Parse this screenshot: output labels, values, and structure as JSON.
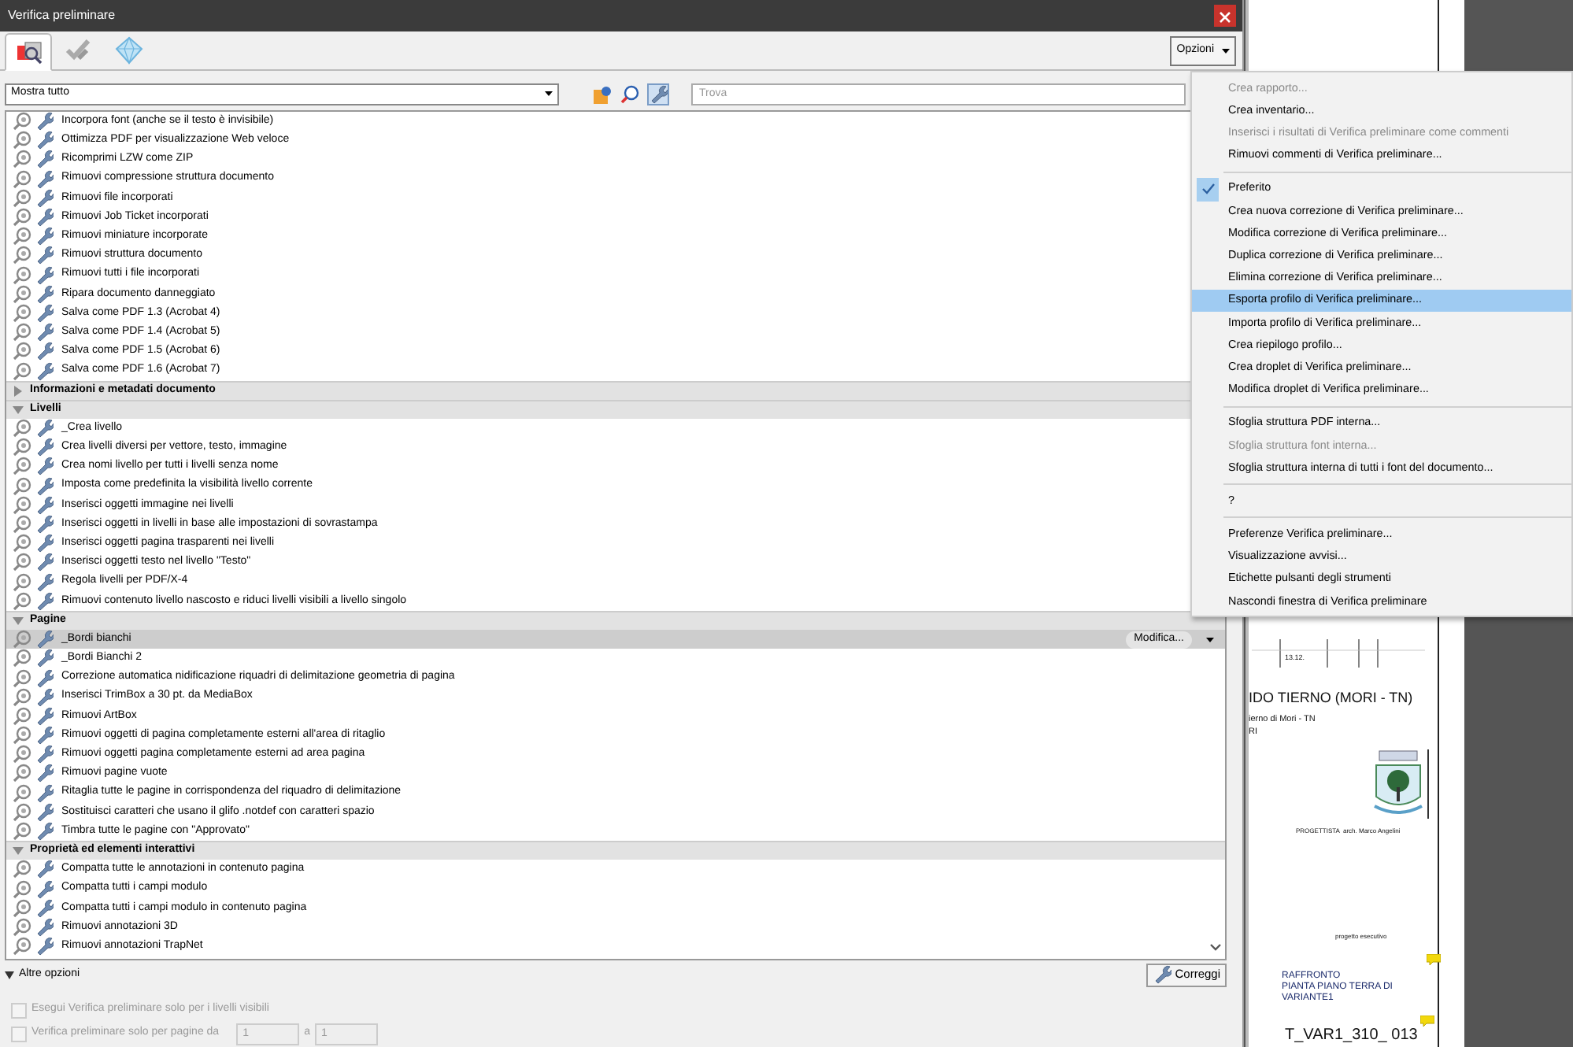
{
  "window": {
    "title": "Verifica preliminare"
  },
  "tabs": [
    {
      "kind": "profiles",
      "selected": true
    },
    {
      "kind": "results",
      "selected": false
    },
    {
      "kind": "standards",
      "selected": false
    }
  ],
  "options_button": "Opzioni",
  "filter": {
    "value": "Mostra tutto"
  },
  "view_buttons": [
    {
      "kind": "checks",
      "selected": false
    },
    {
      "kind": "profiles",
      "selected": false
    },
    {
      "kind": "fixups",
      "selected": true
    }
  ],
  "search": {
    "placeholder": "Trova"
  },
  "list": {
    "row_button": "Modifica...",
    "groups": [
      {
        "items": [
          {
            "label": "Incorpora font (anche se il testo è invisibile)",
            "selected": false
          },
          {
            "label": "Ottimizza PDF per visualizzazione Web veloce",
            "selected": false
          },
          {
            "label": "Ricomprimi LZW come ZIP",
            "selected": false
          },
          {
            "label": "Rimuovi compressione struttura documento",
            "selected": false
          },
          {
            "label": "Rimuovi file incorporati",
            "selected": false
          },
          {
            "label": "Rimuovi Job Ticket incorporati",
            "selected": false
          },
          {
            "label": "Rimuovi miniature incorporate",
            "selected": false
          },
          {
            "label": "Rimuovi struttura documento",
            "selected": false
          },
          {
            "label": "Rimuovi tutti i file incorporati",
            "selected": false
          },
          {
            "label": "Ripara documento danneggiato",
            "selected": false
          },
          {
            "label": "Salva come PDF 1.3 (Acrobat 4)",
            "selected": false
          },
          {
            "label": "Salva come PDF 1.4 (Acrobat 5)",
            "selected": false
          },
          {
            "label": "Salva come PDF 1.5 (Acrobat 6)",
            "selected": false
          },
          {
            "label": "Salva come PDF 1.6 (Acrobat 7)",
            "selected": false
          }
        ]
      },
      {
        "title": "Informazioni e metadati documento",
        "expanded": false
      },
      {
        "title": "Livelli",
        "expanded": true,
        "items": [
          {
            "label": "_Crea livello",
            "selected": false
          },
          {
            "label": "Crea livelli diversi per vettore, testo, immagine",
            "selected": false
          },
          {
            "label": "Crea nomi livello per tutti i livelli senza nome",
            "selected": false
          },
          {
            "label": "Imposta come predefinita la visibilità livello corrente",
            "selected": false
          },
          {
            "label": "Inserisci oggetti immagine nei livelli",
            "selected": false
          },
          {
            "label": "Inserisci oggetti in livelli in base alle impostazioni di sovrastampa",
            "selected": false
          },
          {
            "label": "Inserisci oggetti pagina trasparenti nei livelli",
            "selected": false
          },
          {
            "label": "Inserisci oggetti testo nel livello \"Testo\"",
            "selected": false
          },
          {
            "label": "Regola livelli per PDF/X-4",
            "selected": false
          },
          {
            "label": "Rimuovi contenuto livello nascosto e riduci livelli visibili a livello singolo",
            "selected": false
          }
        ]
      },
      {
        "title": "Pagine",
        "expanded": true,
        "items": [
          {
            "label": "_Bordi bianchi",
            "selected": true
          },
          {
            "label": "_Bordi Bianchi 2",
            "selected": false
          },
          {
            "label": "Correzione automatica nidificazione riquadri di delimitazione geometria di pagina",
            "selected": false
          },
          {
            "label": "Inserisci TrimBox a 30 pt. da MediaBox",
            "selected": false
          },
          {
            "label": "Rimuovi ArtBox",
            "selected": false
          },
          {
            "label": "Rimuovi oggetti di pagina completamente esterni all'area di ritaglio",
            "selected": false
          },
          {
            "label": "Rimuovi oggetti pagina completamente esterni ad area pagina",
            "selected": false
          },
          {
            "label": "Rimuovi pagine vuote",
            "selected": false
          },
          {
            "label": "Ritaglia tutte le pagine in corrispondenza del riquadro di delimitazione",
            "selected": false
          },
          {
            "label": "Sostituisci caratteri che usano il glifo .notdef con caratteri spazio",
            "selected": false
          },
          {
            "label": "Timbra tutte le pagine con \"Approvato\"",
            "selected": false
          }
        ]
      },
      {
        "title": "Proprietà ed elementi interattivi",
        "expanded": true,
        "items": [
          {
            "label": "Compatta tutte le annotazioni in contenuto pagina",
            "selected": false
          },
          {
            "label": "Compatta tutti i campi modulo",
            "selected": false
          },
          {
            "label": "Compatta tutti i campi modulo in contenuto pagina",
            "selected": false
          },
          {
            "label": "Rimuovi annotazioni 3D",
            "selected": false
          },
          {
            "label": "Rimuovi annotazioni TrapNet",
            "selected": false
          }
        ]
      }
    ]
  },
  "fix_button": "Correggi",
  "more_options": {
    "label": "Altre opzioni",
    "expanded": true,
    "options": [
      {
        "label": "Esegui Verifica preliminare solo per i livelli visibili",
        "checked": false,
        "disabled": true
      },
      {
        "label": "Verifica preliminare solo per pagine da",
        "checked": false,
        "disabled": true,
        "from": "1",
        "to_label": "a",
        "to": "1"
      }
    ]
  },
  "menu": [
    {
      "kind": "item",
      "label": "Crea rapporto...",
      "disabled": true,
      "checked": false,
      "selected": false
    },
    {
      "kind": "item",
      "label": "Crea inventario...",
      "disabled": false,
      "checked": false,
      "selected": false
    },
    {
      "kind": "item",
      "label": "Inserisci i risultati di Verifica preliminare come commenti",
      "disabled": true,
      "checked": false,
      "selected": false
    },
    {
      "kind": "item",
      "label": "Rimuovi commenti di Verifica preliminare...",
      "disabled": false,
      "checked": false,
      "selected": false
    },
    {
      "kind": "separator"
    },
    {
      "kind": "item",
      "label": "Preferito",
      "disabled": false,
      "checked": true,
      "selected": false
    },
    {
      "kind": "item",
      "label": "Crea nuova correzione di Verifica preliminare...",
      "disabled": false,
      "checked": false,
      "selected": false
    },
    {
      "kind": "item",
      "label": "Modifica correzione di Verifica preliminare...",
      "disabled": false,
      "checked": false,
      "selected": false
    },
    {
      "kind": "item",
      "label": "Duplica correzione di Verifica preliminare...",
      "disabled": false,
      "checked": false,
      "selected": false
    },
    {
      "kind": "item",
      "label": "Elimina correzione di Verifica preliminare...",
      "disabled": false,
      "checked": false,
      "selected": false
    },
    {
      "kind": "item",
      "label": "Esporta profilo di Verifica preliminare...",
      "disabled": false,
      "checked": false,
      "selected": true
    },
    {
      "kind": "item",
      "label": "Importa profilo di Verifica preliminare...",
      "disabled": false,
      "checked": false,
      "selected": false
    },
    {
      "kind": "item",
      "label": "Crea riepilogo profilo...",
      "disabled": false,
      "checked": false,
      "selected": false
    },
    {
      "kind": "item",
      "label": "Crea droplet di Verifica preliminare...",
      "disabled": false,
      "checked": false,
      "selected": false
    },
    {
      "kind": "item",
      "label": "Modifica droplet di Verifica preliminare...",
      "disabled": false,
      "checked": false,
      "selected": false
    },
    {
      "kind": "separator"
    },
    {
      "kind": "item",
      "label": "Sfoglia struttura PDF interna...",
      "disabled": false,
      "checked": false,
      "selected": false
    },
    {
      "kind": "item",
      "label": "Sfoglia struttura font interna...",
      "disabled": true,
      "checked": false,
      "selected": false
    },
    {
      "kind": "item",
      "label": "Sfoglia struttura interna di tutti i font del documento...",
      "disabled": false,
      "checked": false,
      "selected": false
    },
    {
      "kind": "separator"
    },
    {
      "kind": "item",
      "label": "?",
      "disabled": false,
      "checked": false,
      "selected": false
    },
    {
      "kind": "separator"
    },
    {
      "kind": "item",
      "label": "Preferenze Verifica preliminare...",
      "disabled": false,
      "checked": false,
      "selected": false
    },
    {
      "kind": "item",
      "label": "Visualizzazione avvisi...",
      "disabled": false,
      "checked": false,
      "selected": false
    },
    {
      "kind": "item",
      "label": "Etichette pulsanti degli strumenti",
      "disabled": false,
      "checked": false,
      "selected": false
    },
    {
      "kind": "item",
      "label": "Nascondi finestra di Verifica preliminare",
      "disabled": false,
      "checked": false,
      "selected": false
    }
  ],
  "document": {
    "date": "13.12.",
    "title": "IDO TIERNO (MORI - TN)",
    "lines": [
      "ierno di Mori - TN",
      "RI"
    ],
    "designer_label": "PROGETTISTA",
    "designer": "arch. Marco Angelini",
    "phase": "progetto esecutivo",
    "subject_lines": [
      "RAFFRONTO",
      "PIANTA PIANO TERRA DI",
      "VARIANTE1"
    ],
    "code": "T_VAR1_310_ 013"
  }
}
